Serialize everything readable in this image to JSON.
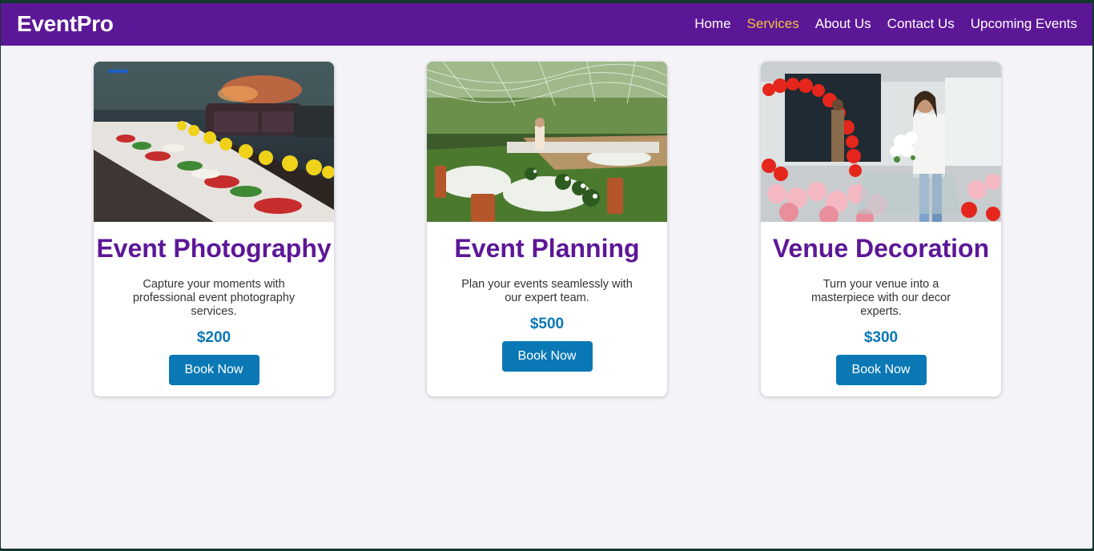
{
  "header": {
    "brand": "EventPro",
    "nav": [
      {
        "label": "Home",
        "active": false
      },
      {
        "label": "Services",
        "active": true
      },
      {
        "label": "About Us",
        "active": false
      },
      {
        "label": "Contact Us",
        "active": false
      },
      {
        "label": "Upcoming Events",
        "active": false
      }
    ]
  },
  "services": [
    {
      "title": "Event Photography",
      "description": "Capture your moments with professional event photography services.",
      "price": "$200",
      "button_label": "Book Now",
      "image": "catering-buffet-photo"
    },
    {
      "title": "Event Planning",
      "description": "Plan your events seamlessly with our expert team.",
      "price": "$500",
      "button_label": "Book Now",
      "image": "garden-reception-photo"
    },
    {
      "title": "Venue Decoration",
      "description": "Turn your venue into a masterpiece with our decor experts.",
      "price": "$300",
      "button_label": "Book Now",
      "image": "balloon-decoration-photo"
    }
  ],
  "colors": {
    "navbar": "#5c1797",
    "active_nav": "#f6c142",
    "title": "#5c1797",
    "accent": "#0a78b5",
    "background": "#f4f3f8"
  }
}
